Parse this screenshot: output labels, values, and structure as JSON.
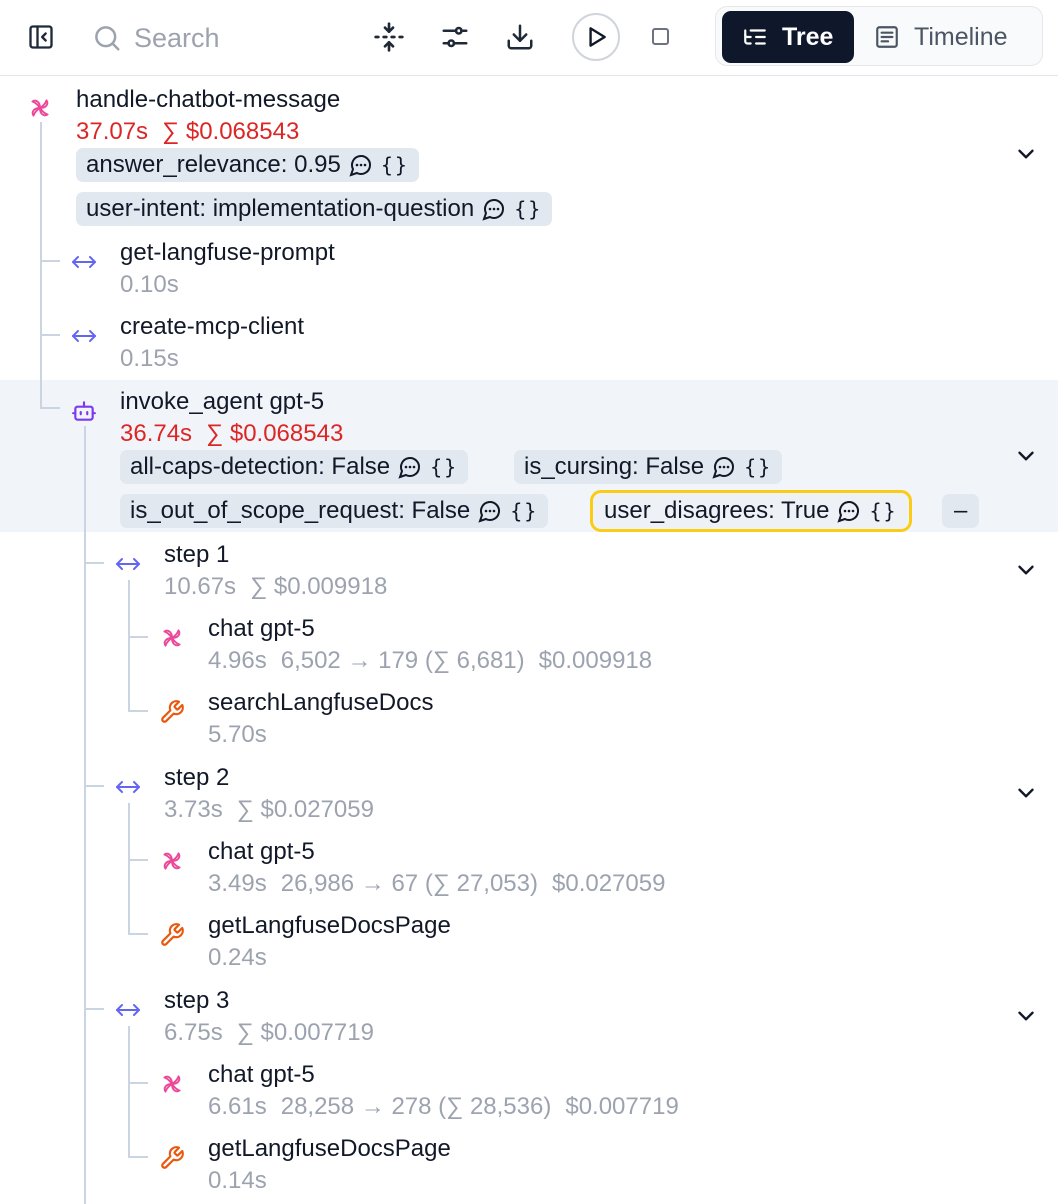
{
  "toolbar": {
    "search_placeholder": "Search",
    "view_tree": "Tree",
    "view_timeline": "Timeline"
  },
  "colors": {
    "error_red": "#dc2626",
    "muted": "#9ca3af",
    "accent_purple": "#7c3aed",
    "tool_orange": "#ea580c",
    "gen_pink": "#ec4899",
    "span_blue": "#6366f1"
  },
  "tree": {
    "root": {
      "name": "handle-chatbot-message",
      "duration": "37.07s",
      "cost": "∑ $0.068543",
      "scores": [
        "answer_relevance: 0.95",
        "user-intent: implementation-question"
      ]
    },
    "prompt": {
      "name": "get-langfuse-prompt",
      "duration": "0.10s"
    },
    "mcp": {
      "name": "create-mcp-client",
      "duration": "0.15s"
    },
    "agent": {
      "name": "invoke_agent gpt-5",
      "duration": "36.74s",
      "cost": "∑ $0.068543",
      "scores": [
        "all-caps-detection: False",
        "is_cursing: False",
        "is_out_of_scope_request: False",
        "user_disagrees: True"
      ],
      "more": "–"
    },
    "step1": {
      "name": "step 1",
      "duration": "10.67s",
      "cost": "∑ $0.009918",
      "chat": {
        "name": "chat gpt-5",
        "duration": "4.96s",
        "tokens": "6,502 → 179 (∑ 6,681)",
        "cost": "$0.009918"
      },
      "tool": {
        "name": "searchLangfuseDocs",
        "duration": "5.70s"
      }
    },
    "step2": {
      "name": "step 2",
      "duration": "3.73s",
      "cost": "∑ $0.027059",
      "chat": {
        "name": "chat gpt-5",
        "duration": "3.49s",
        "tokens": "26,986 → 67 (∑ 27,053)",
        "cost": "$0.027059"
      },
      "tool": {
        "name": "getLangfuseDocsPage",
        "duration": "0.24s"
      }
    },
    "step3": {
      "name": "step 3",
      "duration": "6.75s",
      "cost": "∑ $0.007719",
      "chat": {
        "name": "chat gpt-5",
        "duration": "6.61s",
        "tokens": "28,258 → 278 (∑ 28,536)",
        "cost": "$0.007719"
      },
      "tool": {
        "name": "getLangfuseDocsPage",
        "duration": "0.14s"
      }
    }
  }
}
